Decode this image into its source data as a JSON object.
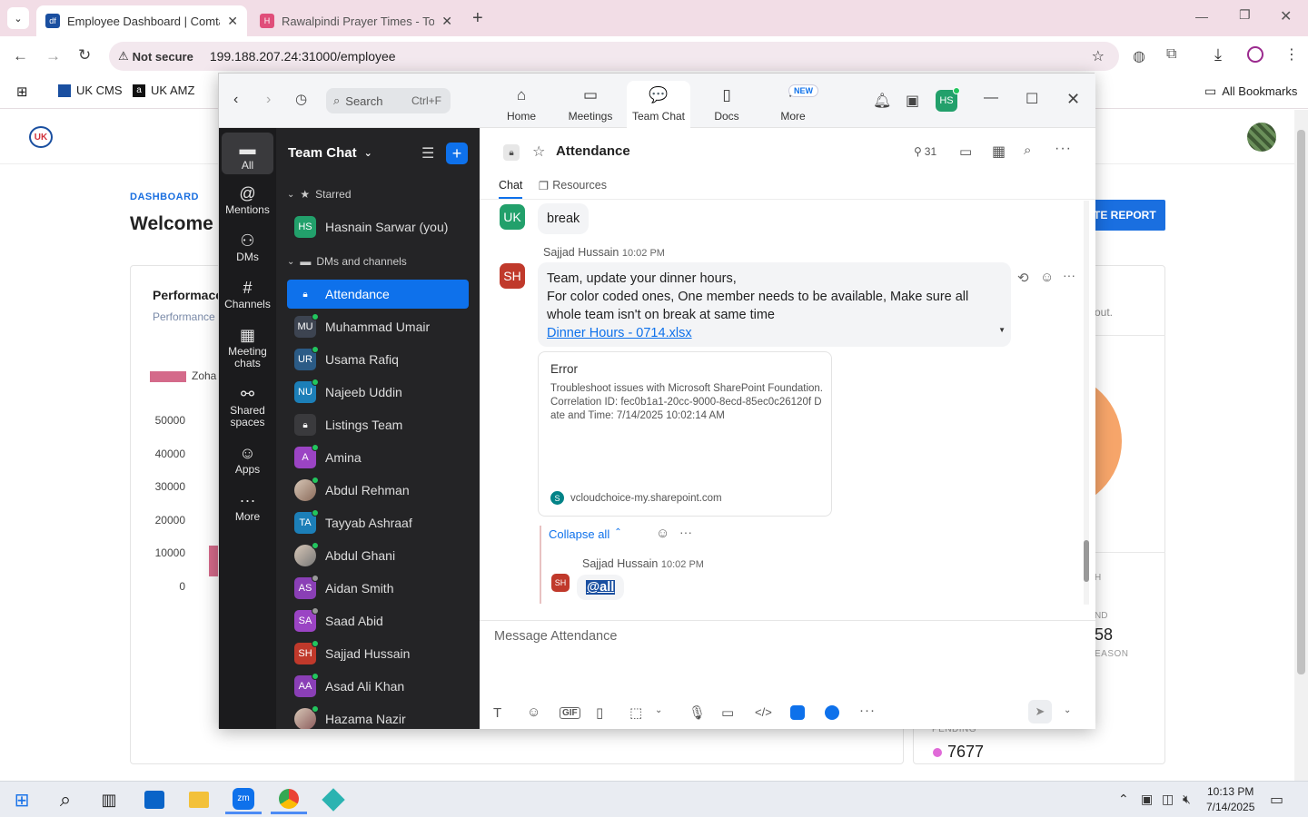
{
  "browser": {
    "tabs": [
      {
        "title": "Employee Dashboard | Comtan",
        "active": true
      },
      {
        "title": "Rawalpindi Prayer Times - Toda",
        "active": false
      }
    ],
    "security_label": "Not secure",
    "url": "199.188.207.24:31000/employee",
    "bookmarks": [
      "UK CMS",
      "UK AMZ"
    ],
    "all_bookmarks": "All Bookmarks"
  },
  "dashboard": {
    "breadcrumb": "DASHBOARD",
    "welcome": "Welcome t",
    "report_button": "TE REPORT",
    "performance_title": "Performace",
    "performance_sub": "Performance",
    "legend_label": "Zoha",
    "y_ticks": [
      "50000",
      "40000",
      "30000",
      "20000",
      "10000",
      "0"
    ],
    "side_text": "out.",
    "stat_value": "58",
    "stat_label_partial": "EASON",
    "stat_label_top": "ND",
    "stat_label_h": "H",
    "pending_label": "PENDING",
    "pending_value": "7677"
  },
  "zoom": {
    "search_placeholder": "Search",
    "search_shortcut": "Ctrl+F",
    "nav_tabs": [
      {
        "label": "Home",
        "icon": "home-icon"
      },
      {
        "label": "Meetings",
        "icon": "video-icon"
      },
      {
        "label": "Team Chat",
        "icon": "chat-icon"
      },
      {
        "label": "Docs",
        "icon": "doc-icon"
      },
      {
        "label": "More",
        "icon": "more-icon"
      }
    ],
    "new_badge": "NEW",
    "user_initials": "HS",
    "rail": [
      {
        "label": "All",
        "icon": "chat-bubble-icon"
      },
      {
        "label": "Mentions",
        "icon": "at-icon"
      },
      {
        "label": "DMs",
        "icon": "people-icon"
      },
      {
        "label": "Channels",
        "icon": "hash-icon"
      },
      {
        "label": "Meeting chats",
        "icon": "calendar-icon"
      },
      {
        "label": "Shared spaces",
        "icon": "shared-icon"
      },
      {
        "label": "Apps",
        "icon": "apps-icon"
      },
      {
        "label": "More",
        "icon": "ellipsis-icon"
      }
    ],
    "chatlist_title": "Team Chat",
    "section_starred": "Starred",
    "section_dms": "DMs and channels",
    "starred": [
      {
        "initials": "HS",
        "name": "Hasnain Sarwar (you)",
        "color": "#22a06b"
      }
    ],
    "contacts": [
      {
        "initials": "",
        "name": "Attendance",
        "color": "#0e71eb",
        "type": "lock"
      },
      {
        "initials": "MU",
        "name": "Muhammad Umair",
        "color": "#3d4451"
      },
      {
        "initials": "UR",
        "name": "Usama Rafiq",
        "color": "#2b5b86"
      },
      {
        "initials": "NU",
        "name": "Najeeb Uddin",
        "color": "#1c7fb8"
      },
      {
        "initials": "",
        "name": "Listings Team",
        "color": "#3a3a3d",
        "type": "lock"
      },
      {
        "initials": "A",
        "name": "Amina",
        "color": "#9b44c4"
      },
      {
        "initials": "",
        "name": "Abdul Rehman",
        "color": "#8a6a5a",
        "type": "photo"
      },
      {
        "initials": "TA",
        "name": "Tayyab Ashraaf",
        "color": "#1c7fb8"
      },
      {
        "initials": "",
        "name": "Abdul Ghani",
        "color": "#777",
        "type": "photo"
      },
      {
        "initials": "AS",
        "name": "Aidan Smith",
        "color": "#8a3fb6"
      },
      {
        "initials": "SA",
        "name": "Saad Abid",
        "color": "#9b44c4"
      },
      {
        "initials": "SH",
        "name": "Sajjad Hussain",
        "color": "#c0392b"
      },
      {
        "initials": "AA",
        "name": "Asad Ali Khan",
        "color": "#8a3fb6"
      },
      {
        "initials": "",
        "name": "Hazama Nazir",
        "color": "#8a5a5a",
        "type": "photo"
      }
    ],
    "channel": {
      "name": "Attendance",
      "member_count": "31",
      "tabs": [
        "Chat",
        "Resources"
      ]
    },
    "messages": {
      "first_initials": "UK",
      "first_text": "break",
      "sender": "Sajjad Hussain",
      "time": "10:02 PM",
      "sender_initials": "SH",
      "lines": [
        "Team, update your dinner hours,",
        "For color coded ones, One member needs to be available, Make sure all",
        "whole team isn't on break at same time"
      ],
      "link": "Dinner Hours - 0714.xlsx",
      "error_title": "Error",
      "error_body": "Troubleshoot issues with Microsoft SharePoint Foundation. Correlation ID: fec0b1a1-20cc-9000-8ecd-85ec0c26120f Date and Time: 7/14/2025 10:02:14 AM",
      "error_source": "vcloudchoice-my.sharepoint.com",
      "collapse": "Collapse all",
      "reply_sender": "Sajjad Hussain",
      "reply_time": "10:02 PM",
      "reply_text": "@all"
    },
    "composer_placeholder": "Message Attendance"
  },
  "taskbar": {
    "time": "10:13 PM",
    "date": "7/14/2025"
  },
  "colors": {
    "zoom_blue": "#0e71eb",
    "tab_bar": "#f2dde6",
    "report_blue": "#1a6fe0"
  }
}
